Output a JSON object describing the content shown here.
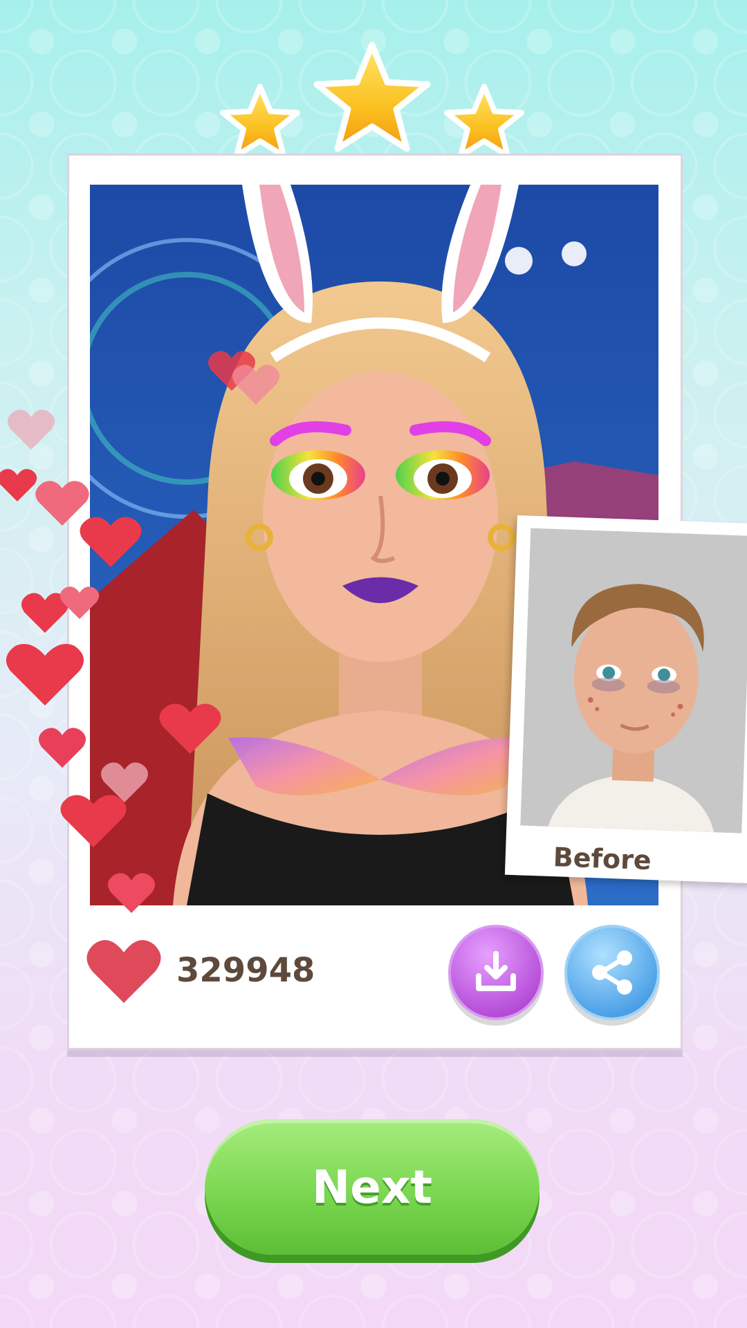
{
  "rating": {
    "stars": 3,
    "max": 3
  },
  "likes": {
    "count": "329948"
  },
  "before_card": {
    "label": "Before"
  },
  "actions": {
    "download_icon": "download-icon",
    "share_icon": "share-icon"
  },
  "next_button": {
    "label": "Next"
  },
  "colors": {
    "star": "#f7b51c",
    "heart": "#e23a4a",
    "download_button": "#b44bd6",
    "share_button": "#4a9fe6",
    "next_button": "#7bd750",
    "text_brown": "#5d4a3c"
  }
}
